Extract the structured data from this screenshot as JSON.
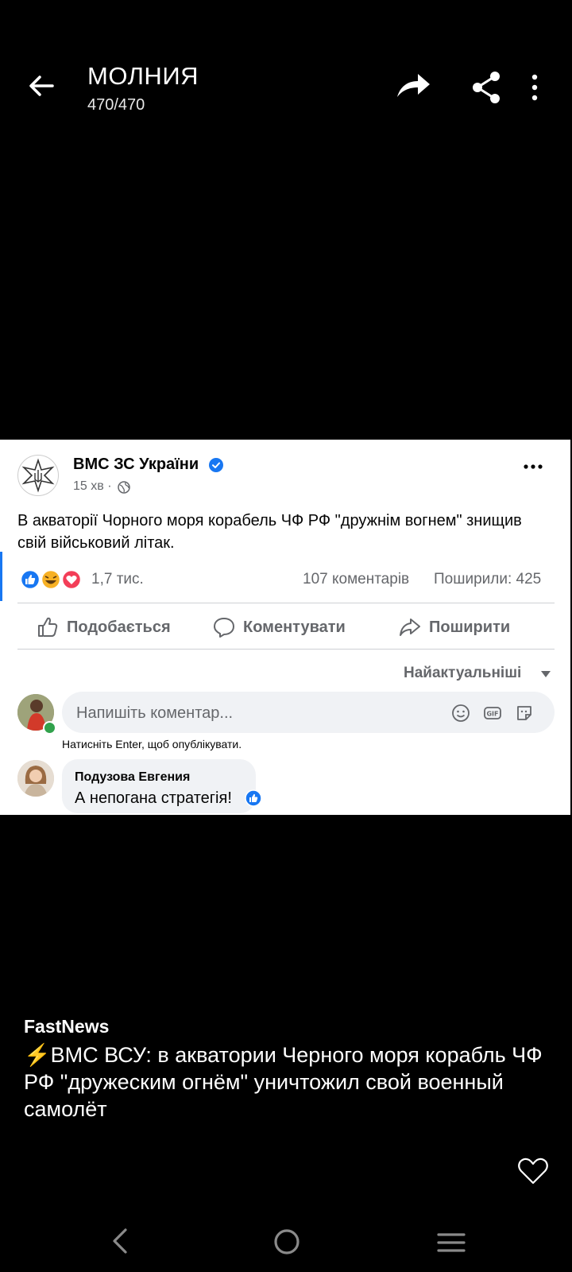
{
  "viewer": {
    "title": "МОЛНИЯ",
    "counter": "470/470"
  },
  "post": {
    "page_name": "ВМС ЗС України",
    "time": "15 хв ·",
    "text": "В акваторії Чорного моря корабель ЧФ РФ \"дружнім вогнем\" знищив свій військовий літак.",
    "reactions_count": "1,7 тис.",
    "comments_count": "107 коментарів",
    "shares_count": "Поширили: 425",
    "actions": {
      "like": "Подобається",
      "comment": "Коментувати",
      "share": "Поширити"
    },
    "sort_label": "Найактуальніші",
    "comment_placeholder": "Напишіть коментар...",
    "enter_hint": "Натисніть Enter, щоб опублікувати.",
    "comment": {
      "author": "Подузова Евгения",
      "text": "А непогана стратегія!"
    }
  },
  "caption": {
    "source": "FastNews",
    "text": "⚡️ВМС ВСУ: в акватории Черного моря корабль ЧФ РФ \"дружеским огнём\" уничтожил свой военный самолёт"
  },
  "colors": {
    "facebook_blue": "#1877f2",
    "secondary_text": "#65676b",
    "comment_bg": "#f0f2f5"
  }
}
